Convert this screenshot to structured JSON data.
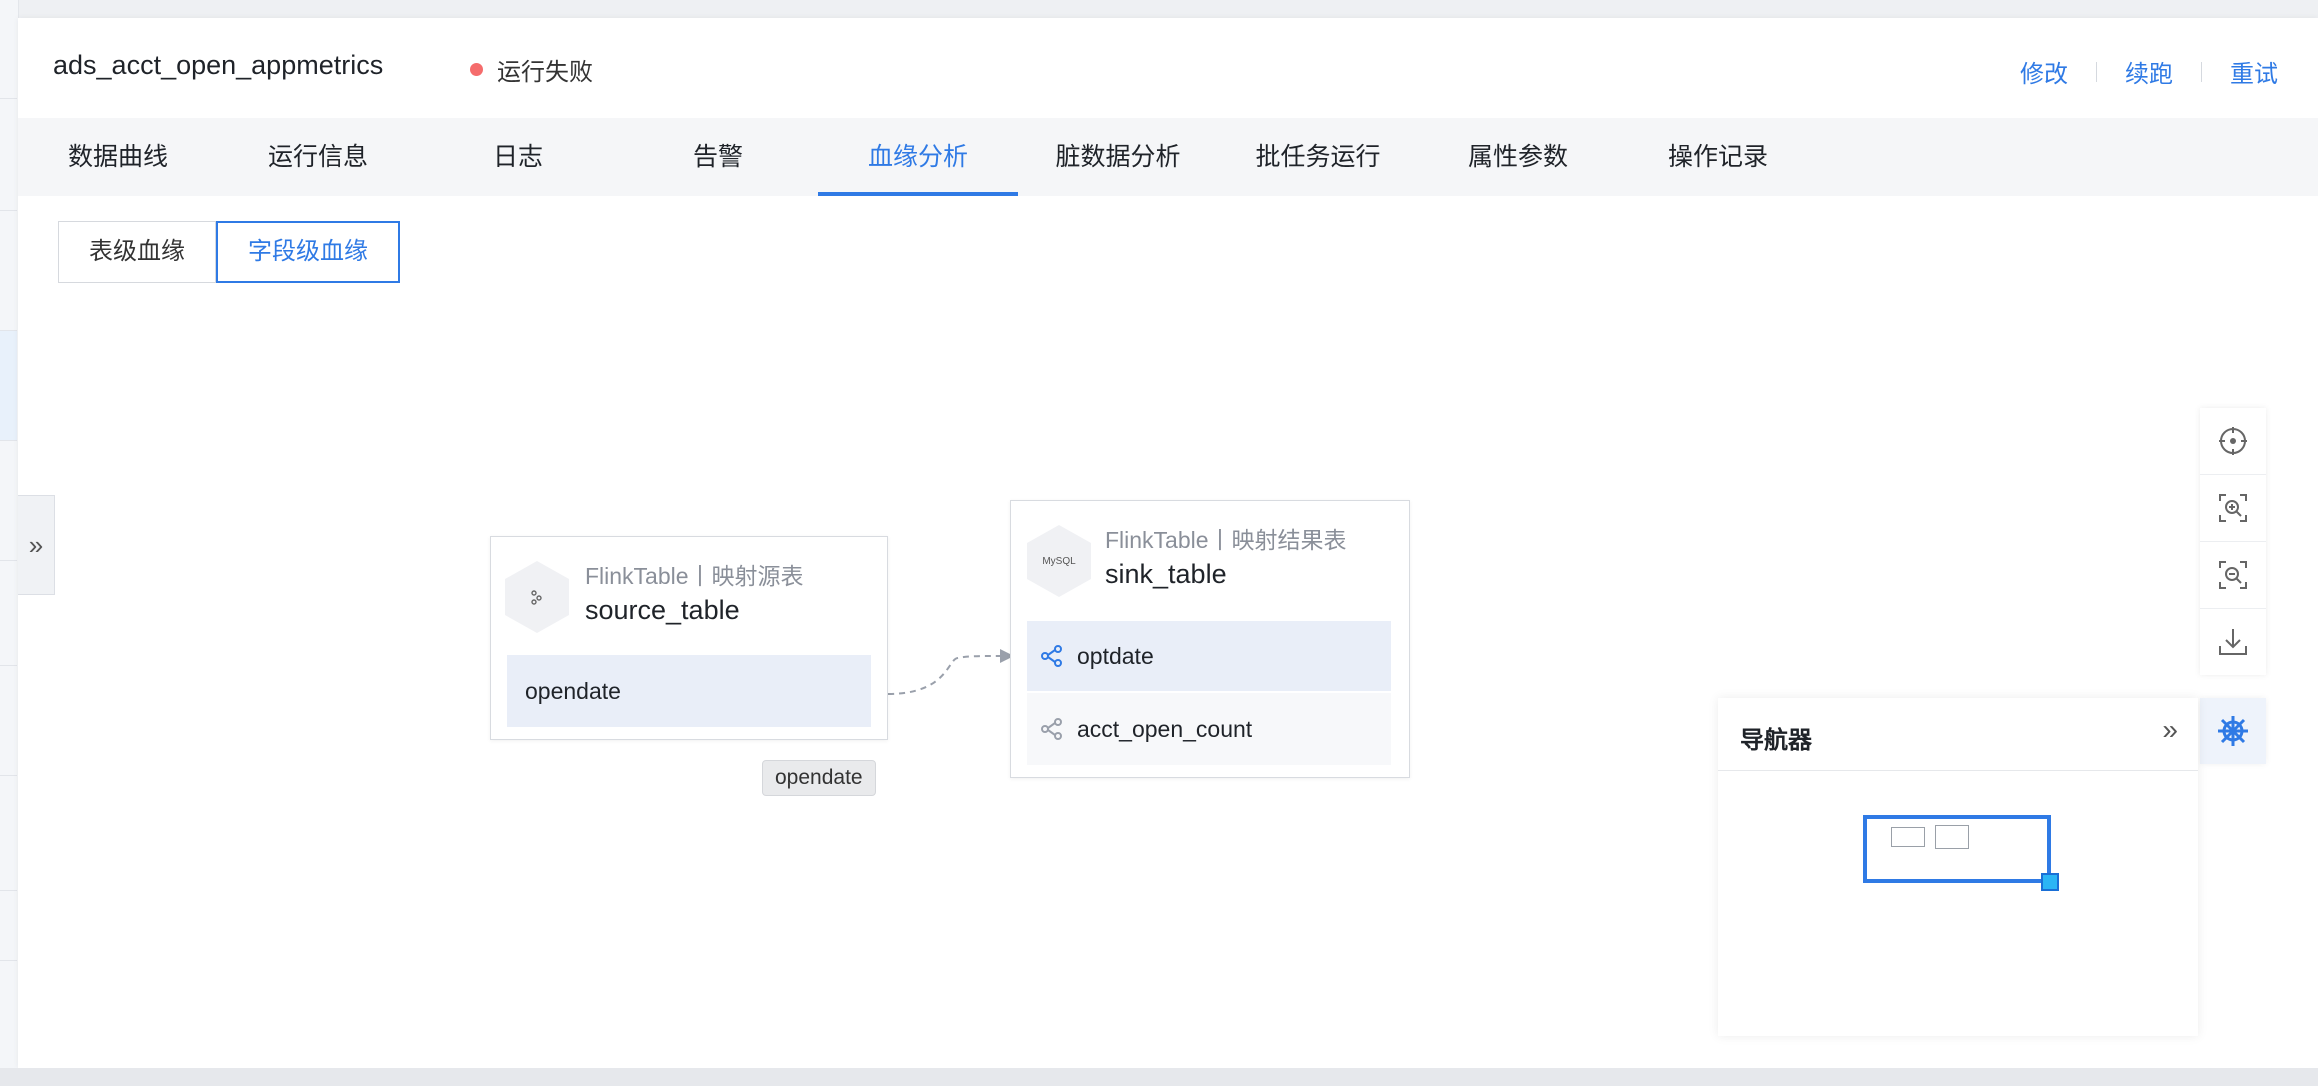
{
  "header": {
    "title": "ads_acct_open_appmetrics",
    "status": "运行失败",
    "status_color": "#f56c6c",
    "actions": {
      "edit": "修改",
      "resume": "续跑",
      "retry": "重试"
    }
  },
  "tabs": {
    "items": [
      {
        "label": "数据曲线"
      },
      {
        "label": "运行信息"
      },
      {
        "label": "日志"
      },
      {
        "label": "告警"
      },
      {
        "label": "血缘分析"
      },
      {
        "label": "脏数据分析"
      },
      {
        "label": "批任务运行"
      },
      {
        "label": "属性参数"
      },
      {
        "label": "操作记录"
      }
    ],
    "active": "血缘分析"
  },
  "lineage_mode": {
    "table": "表级血缘",
    "field": "字段级血缘",
    "active": "字段级血缘"
  },
  "graph": {
    "source": {
      "type": "FlinkTable丨映射源表",
      "name": "source_table",
      "icon": "flink-icon",
      "fields": [
        "opendate"
      ]
    },
    "sink": {
      "type": "FlinkTable丨映射结果表",
      "name": "sink_table",
      "icon_text": "MySQL",
      "fields": [
        "optdate",
        "acct_open_count"
      ]
    },
    "edge_label": "opendate"
  },
  "navigator": {
    "title": "导航器"
  },
  "toolbar": [
    "locate-icon",
    "zoom-in-icon",
    "zoom-out-icon",
    "download-icon",
    "helm-icon"
  ],
  "accent_color": "#2f7ae5"
}
